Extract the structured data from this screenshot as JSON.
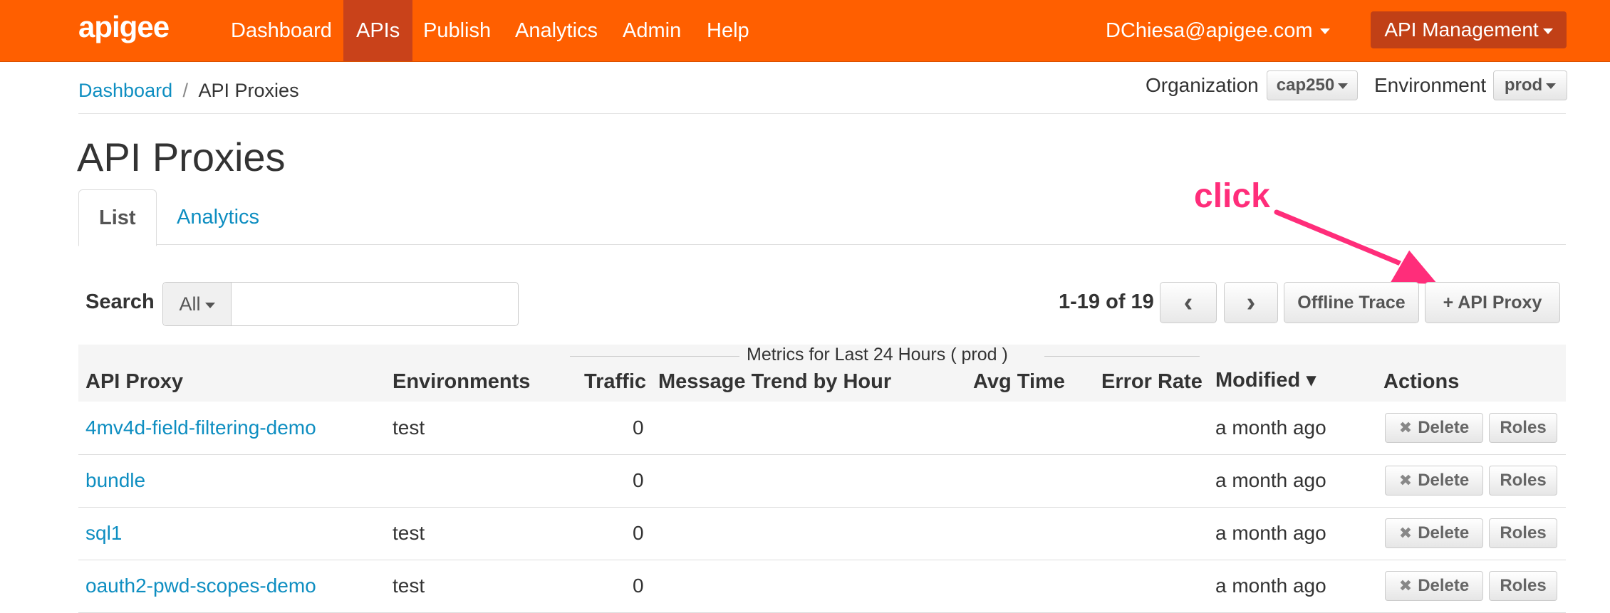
{
  "topnav": {
    "logo": "apigee",
    "items": [
      "Dashboard",
      "APIs",
      "Publish",
      "Analytics",
      "Admin",
      "Help"
    ],
    "active_index": 1,
    "user": "DChiesa@apigee.com",
    "api_management": "API Management"
  },
  "breadcrumb": {
    "root": "Dashboard",
    "separator": "/",
    "current": "API Proxies"
  },
  "selectors": {
    "org_label": "Organization",
    "org_value": "cap250",
    "env_label": "Environment",
    "env_value": "prod"
  },
  "page": {
    "title": "API Proxies"
  },
  "tabs": [
    "List",
    "Analytics"
  ],
  "search": {
    "label": "Search",
    "scope": "All",
    "value": ""
  },
  "pager": {
    "text": "1-19 of 19",
    "prev": "‹",
    "next": "›"
  },
  "buttons": {
    "offline_trace": "Offline Trace",
    "add_proxy": "+ API Proxy"
  },
  "annotation": "click",
  "table": {
    "metrics_caption": "Metrics for Last 24 Hours (   prod   )",
    "headers": {
      "proxy": "API Proxy",
      "environments": "Environments",
      "traffic": "Traffic",
      "trend": "Message Trend by Hour",
      "avg_time": "Avg Time",
      "error_rate": "Error Rate",
      "modified": "Modified ▾",
      "actions": "Actions"
    },
    "rows": [
      {
        "name": "4mv4d-field-filtering-demo",
        "env": "test",
        "traffic": "0",
        "modified": "a month ago"
      },
      {
        "name": "bundle",
        "env": "",
        "traffic": "0",
        "modified": "a month ago"
      },
      {
        "name": "sql1",
        "env": "test",
        "traffic": "0",
        "modified": "a month ago"
      },
      {
        "name": "oauth2-pwd-scopes-demo",
        "env": "test",
        "traffic": "0",
        "modified": "a month ago"
      }
    ],
    "delete_label": "Delete",
    "roles_label": "Roles"
  },
  "colors": {
    "brand_orange": "#ff5f00",
    "active_nav": "#c9421a",
    "link_blue": "#0e8ec1",
    "annotation_pink": "#ff2d7a"
  }
}
